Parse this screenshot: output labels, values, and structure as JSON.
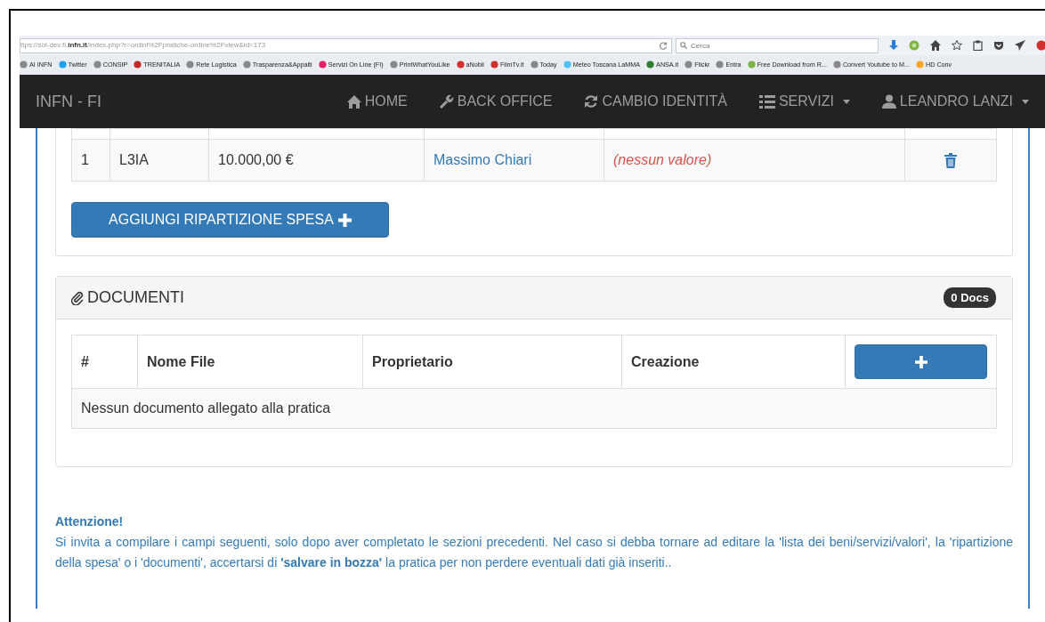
{
  "browser": {
    "url": "ttps://sol-dev.fi.**infn.it**/index.php?r=ordini%2Fpratiche-ordine%2Fview&id=173",
    "search_placeholder": "Cerca",
    "bookmarks": [
      "AI INFN",
      "Twitter",
      "CONSIP",
      "TRENITALIA",
      "Rete Logistica",
      "Trasparenza&Appalti",
      "Servizi On Line (FI)",
      "PrintWhatYouLike",
      "aNobii",
      "FilmTv.it",
      "Today",
      "Meteo Toscana LaMMA",
      "ANSA.it",
      "Flickr",
      "Entra",
      "Free Download from R...",
      "Convert Youtube to M...",
      "HD Conv"
    ]
  },
  "navbar": {
    "brand": "INFN - FI",
    "items": [
      {
        "label": "HOME",
        "dropdown": false
      },
      {
        "label": "BACK OFFICE",
        "dropdown": false
      },
      {
        "label": "CAMBIO IDENTITÀ",
        "dropdown": false
      },
      {
        "label": "SERVIZI",
        "dropdown": true
      },
      {
        "label": "LEANDRO LANZI",
        "dropdown": true
      }
    ]
  },
  "spese_table": {
    "rows": [
      {
        "cells": [
          {
            "kind": "text",
            "text": "1"
          },
          {
            "kind": "text",
            "text": "L3IA"
          },
          {
            "kind": "text",
            "text": "10.000,00 €"
          },
          {
            "kind": "link",
            "text": "Massimo Chiari"
          },
          {
            "kind": "empty",
            "text": "(nessun valore)"
          }
        ]
      }
    ]
  },
  "add_button": "AGGIUNGI RIPARTIZIONE SPESA",
  "documents": {
    "title": "DOCUMENTI",
    "badge": "0 Docs",
    "columns": [
      "#",
      "Nome File",
      "Proprietario",
      "Creazione"
    ],
    "empty_message": "Nessun documento allegato alla pratica"
  },
  "notice": {
    "title": "Attenzione!",
    "text": "Si invita a compilare i campi seguenti, solo dopo aver completato le sezioni precedenti. Nel caso si debba tornare ad editare la 'lista dei beni/servizi/valori', la 'ripartizione della spesa' o i 'documenti', accertarsi di **'salvare in bozza'** la pratica per non perdere eventuali dati già inseriti.."
  }
}
